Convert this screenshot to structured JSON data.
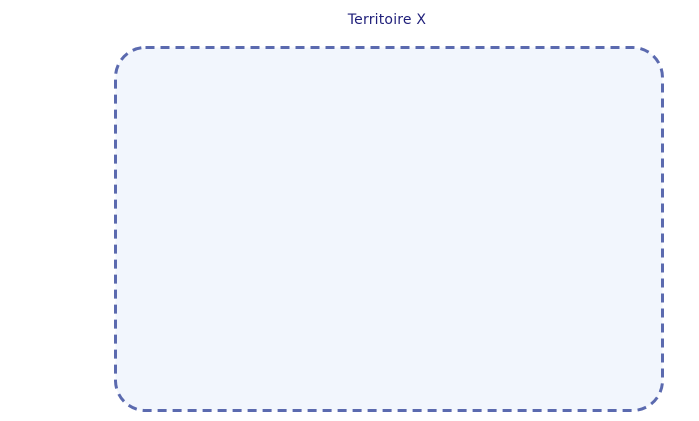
{
  "territory": {
    "label": "Territoire X",
    "fill_color": "#f2f6fd",
    "stroke_color": "#5b6aaf",
    "label_color": "#1f1f7a",
    "border_style": "dashed"
  }
}
